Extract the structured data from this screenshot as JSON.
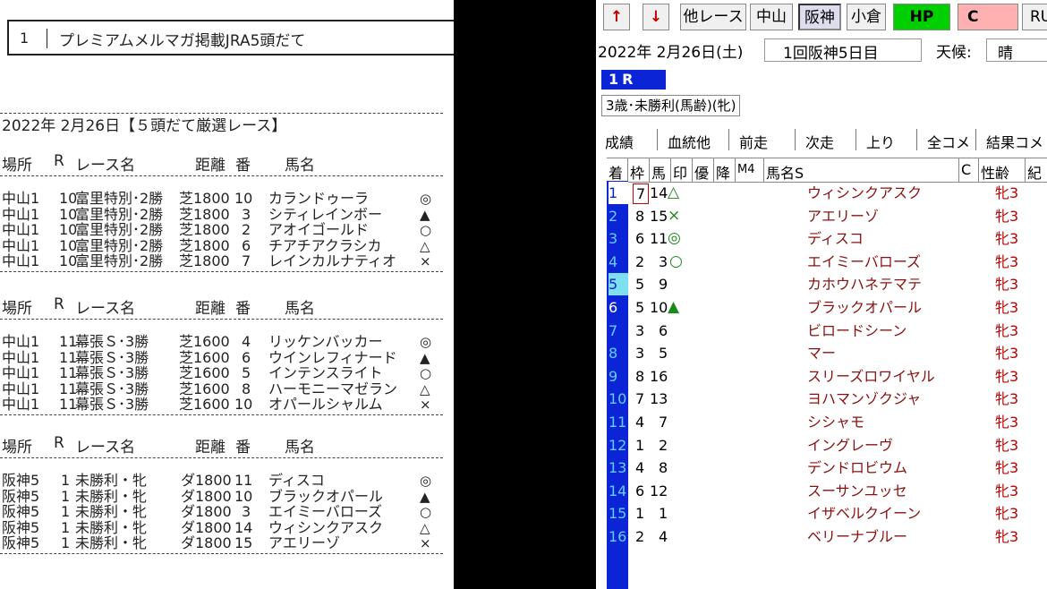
{
  "left": {
    "magazine": {
      "num": "1",
      "title": "プレミアムメルマガ掲載JRA5頭だて"
    },
    "heading": "2022年 2月26日【５頭だて厳選レース】",
    "columns": {
      "place": "場所",
      "r": "R",
      "race": "レース名",
      "dist": "距離",
      "num": "番",
      "horse": "馬名"
    },
    "sections": [
      {
        "rows": [
          {
            "place": "中山1",
            "r": "10",
            "race": "富里特別･2勝",
            "dist": "芝1800",
            "num": "10",
            "horse": "カランドゥーラ",
            "mark": "◎"
          },
          {
            "place": "中山1",
            "r": "10",
            "race": "富里特別･2勝",
            "dist": "芝1800",
            "num": "3",
            "horse": "シティレインボー",
            "mark": "▲"
          },
          {
            "place": "中山1",
            "r": "10",
            "race": "富里特別･2勝",
            "dist": "芝1800",
            "num": "2",
            "horse": "アオイゴールド",
            "mark": "○"
          },
          {
            "place": "中山1",
            "r": "10",
            "race": "富里特別･2勝",
            "dist": "芝1800",
            "num": "6",
            "horse": "チアチアクラシカ",
            "mark": "△"
          },
          {
            "place": "中山1",
            "r": "10",
            "race": "富里特別･2勝",
            "dist": "芝1800",
            "num": "7",
            "horse": "レインカルナティオ",
            "mark": "×"
          }
        ]
      },
      {
        "rows": [
          {
            "place": "中山1",
            "r": "11",
            "race": "幕張Ｓ･3勝",
            "dist": "芝1600",
            "num": "4",
            "horse": "リッケンバッカー",
            "mark": "◎"
          },
          {
            "place": "中山1",
            "r": "11",
            "race": "幕張Ｓ･3勝",
            "dist": "芝1600",
            "num": "6",
            "horse": "ウインレフィナード",
            "mark": "▲"
          },
          {
            "place": "中山1",
            "r": "11",
            "race": "幕張Ｓ･3勝",
            "dist": "芝1600",
            "num": "5",
            "horse": "インテンスライト",
            "mark": "○"
          },
          {
            "place": "中山1",
            "r": "11",
            "race": "幕張Ｓ･3勝",
            "dist": "芝1600",
            "num": "8",
            "horse": "ハーモニーマゼラン",
            "mark": "△"
          },
          {
            "place": "中山1",
            "r": "11",
            "race": "幕張Ｓ･3勝",
            "dist": "芝1600",
            "num": "10",
            "horse": "オパールシャルム",
            "mark": "×"
          }
        ]
      },
      {
        "rows": [
          {
            "place": "阪神5",
            "r": "1",
            "race": "未勝利・牝",
            "dist": "ダ1800",
            "num": "11",
            "horse": "ディスコ",
            "mark": "◎"
          },
          {
            "place": "阪神5",
            "r": "1",
            "race": "未勝利・牝",
            "dist": "ダ1800",
            "num": "10",
            "horse": "ブラックオパール",
            "mark": "▲"
          },
          {
            "place": "阪神5",
            "r": "1",
            "race": "未勝利・牝",
            "dist": "ダ1800",
            "num": "3",
            "horse": "エイミーバローズ",
            "mark": "○"
          },
          {
            "place": "阪神5",
            "r": "1",
            "race": "未勝利・牝",
            "dist": "ダ1800",
            "num": "14",
            "horse": "ウィシンクアスク",
            "mark": "△"
          },
          {
            "place": "阪神5",
            "r": "1",
            "race": "未勝利・牝",
            "dist": "ダ1800",
            "num": "15",
            "horse": "アエリーゾ",
            "mark": "×"
          }
        ]
      }
    ]
  },
  "right": {
    "toolbar": {
      "up": "↑",
      "down": "↓",
      "other": "他レース",
      "nakayama": "中山",
      "hanshin": "阪神",
      "kokura": "小倉",
      "hp": "HP",
      "c": "C",
      "ru": "RU"
    },
    "date": "2022年  2月26日(土)",
    "kaisai": "1回阪神5日目",
    "weather_label": "天候:",
    "weather_value": "晴",
    "race_no": "1R",
    "condition": "3歳･未勝利(馬齢)(牝)",
    "tabs": [
      "成績",
      "血統他",
      "前走",
      "次走",
      "上り",
      "全コメ",
      "結果コメ"
    ],
    "columns": [
      "着",
      "枠",
      "馬",
      "印",
      "優",
      "降",
      "M4",
      "馬名S",
      "C",
      "性齢",
      "紀"
    ],
    "results": [
      {
        "rank": "1",
        "waku": "7",
        "uma": "14",
        "mark": "△",
        "horse": "ウィシンクアスク",
        "sex": "牝3"
      },
      {
        "rank": "2",
        "waku": "8",
        "uma": "15",
        "mark": "×",
        "horse": "アエリーゾ",
        "sex": "牝3"
      },
      {
        "rank": "3",
        "waku": "6",
        "uma": "11",
        "mark": "◎",
        "horse": "ディスコ",
        "sex": "牝3"
      },
      {
        "rank": "4",
        "waku": "2",
        "uma": "3",
        "mark": "○",
        "horse": "エイミーバローズ",
        "sex": "牝3"
      },
      {
        "rank": "5",
        "waku": "5",
        "uma": "9",
        "mark": "",
        "horse": "カホウハネテマテ",
        "sex": "牝3"
      },
      {
        "rank": "6",
        "waku": "5",
        "uma": "10",
        "mark": "▲",
        "horse": "ブラックオパール",
        "sex": "牝3"
      },
      {
        "rank": "7",
        "waku": "3",
        "uma": "6",
        "mark": "",
        "horse": "ビロードシーン",
        "sex": "牝3"
      },
      {
        "rank": "8",
        "waku": "3",
        "uma": "5",
        "mark": "",
        "horse": "マー",
        "sex": "牝3"
      },
      {
        "rank": "9",
        "waku": "8",
        "uma": "16",
        "mark": "",
        "horse": "スリーズロワイヤル",
        "sex": "牝3"
      },
      {
        "rank": "10",
        "waku": "7",
        "uma": "13",
        "mark": "",
        "horse": "ヨハマンゾクジャ",
        "sex": "牝3"
      },
      {
        "rank": "11",
        "waku": "4",
        "uma": "7",
        "mark": "",
        "horse": "シシャモ",
        "sex": "牝3"
      },
      {
        "rank": "12",
        "waku": "1",
        "uma": "2",
        "mark": "",
        "horse": "イングレーヴ",
        "sex": "牝3"
      },
      {
        "rank": "13",
        "waku": "4",
        "uma": "8",
        "mark": "",
        "horse": "デンドロビウム",
        "sex": "牝3"
      },
      {
        "rank": "14",
        "waku": "6",
        "uma": "12",
        "mark": "",
        "horse": "スーサンユッセ",
        "sex": "牝3"
      },
      {
        "rank": "15",
        "waku": "1",
        "uma": "1",
        "mark": "",
        "horse": "イザベルクイーン",
        "sex": "牝3"
      },
      {
        "rank": "16",
        "waku": "2",
        "uma": "4",
        "mark": "",
        "horse": "ベリーナブルー",
        "sex": "牝3"
      }
    ]
  },
  "colors": {
    "rank_bg": "#0a24d6",
    "rank_fg": "#66ccff",
    "hp_bg": "#00d000",
    "c_bg": "#ffb0b0",
    "horse": "#8b1010",
    "sex": "#c00000",
    "mark_green": "#1a8a1a"
  }
}
